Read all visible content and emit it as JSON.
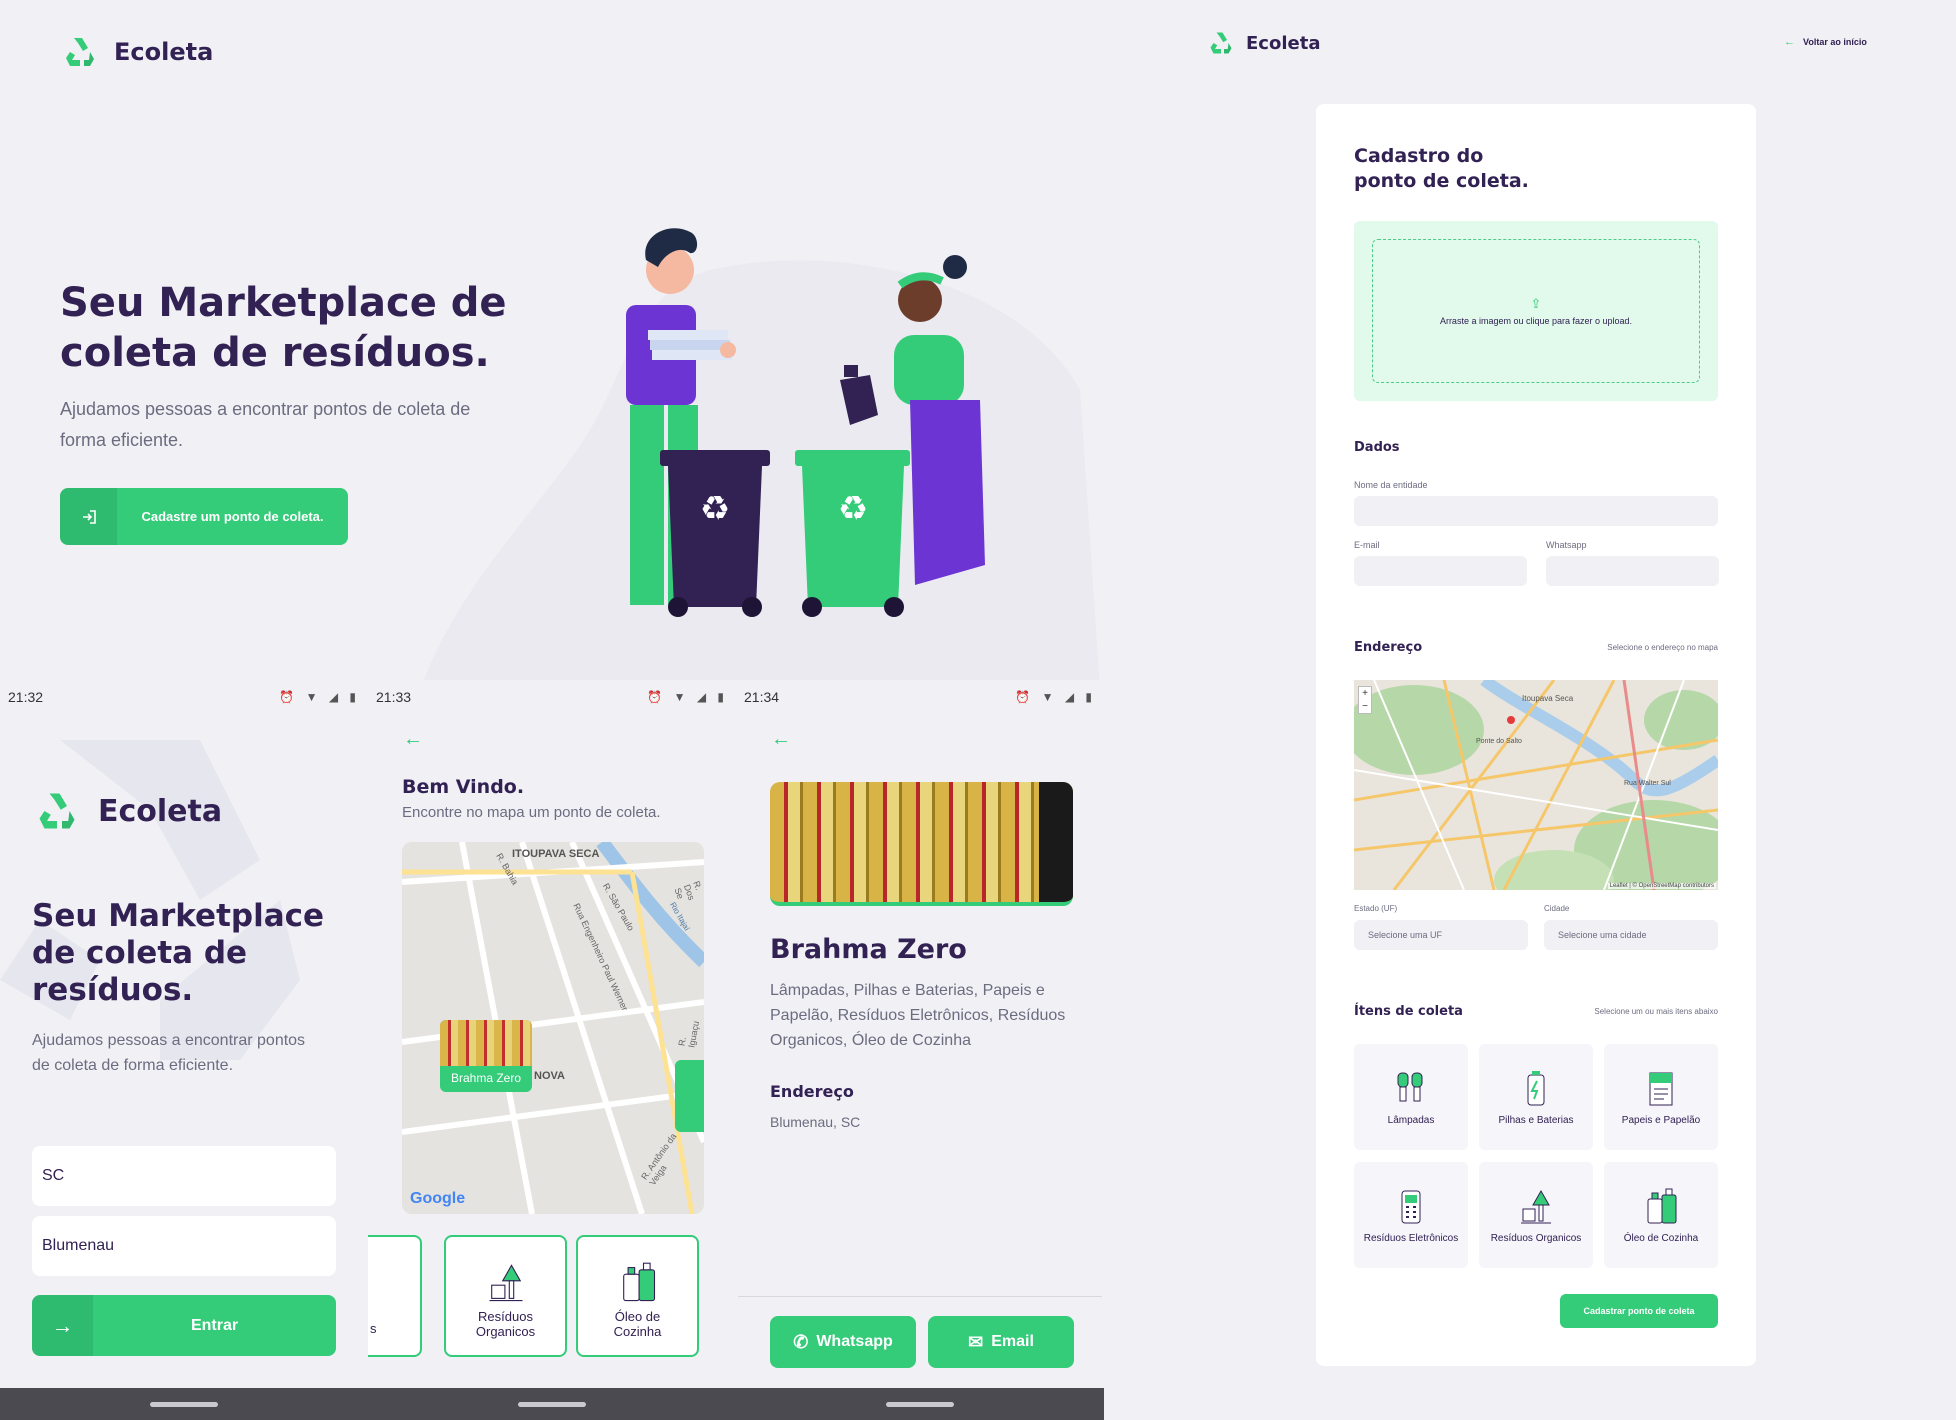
{
  "brand": {
    "name": "Ecoleta",
    "green": "#34cb79",
    "purple": "#322153",
    "gray": "#6c6c80"
  },
  "desktop_home": {
    "title": "Seu Marketplace de coleta de resíduos.",
    "subtitle": "Ajudamos pessoas a encontrar pontos de coleta de forma eficiente.",
    "cta_label": "Cadastre um ponto de coleta."
  },
  "desktop_form": {
    "back_link": "Voltar ao início",
    "title_line1": "Cadastro do",
    "title_line2": "ponto de coleta.",
    "dropzone_text": "Arraste a imagem ou clique para fazer o upload.",
    "section_dados": "Dados",
    "label_nome": "Nome da entidade",
    "label_email": "E-mail",
    "label_whatsapp": "Whatsapp",
    "section_endereco": "Endereço",
    "endereco_hint": "Selecione o endereço no mapa",
    "map_attribution": "Leaflet | © OpenStreetMap contributors",
    "map_places": [
      "Itoupava Seca",
      "Ponte do Salto",
      "Rua Walter Sul"
    ],
    "label_uf": "Estado (UF)",
    "placeholder_uf": "Selecione uma UF",
    "label_cidade": "Cidade",
    "placeholder_cidade": "Selecione uma cidade",
    "section_itens": "Ítens de coleta",
    "itens_hint": "Selecione um ou mais itens abaixo",
    "items": [
      {
        "label": "Lâmpadas",
        "icon": "lamp-icon"
      },
      {
        "label": "Pilhas e Baterias",
        "icon": "battery-icon"
      },
      {
        "label": "Papeis e Papelão",
        "icon": "paper-icon"
      },
      {
        "label": "Resíduos Eletrônicos",
        "icon": "electronics-icon"
      },
      {
        "label": "Resíduos Organicos",
        "icon": "organic-icon"
      },
      {
        "label": "Óleo de Cozinha",
        "icon": "oil-icon"
      }
    ],
    "submit_label": "Cadastrar ponto de coleta"
  },
  "phone_home": {
    "time": "21:32",
    "title": "Seu Marketplace de coleta de resíduos.",
    "subtitle": "Ajudamos pessoas a encontrar pontos de coleta de forma eficiente.",
    "uf_value": "SC",
    "city_value": "Blumenau",
    "enter_label": "Entrar"
  },
  "phone_map": {
    "time": "21:33",
    "title": "Bem Vindo.",
    "subtitle": "Encontre no mapa um ponto de coleta.",
    "marker_label": "Brahma Zero",
    "map_labels": [
      "ITOUPAVA SECA",
      "R. Bahia",
      "R. São Paulo",
      "Rua Engenheiro Paul Werner",
      "NOVA",
      "R. Antônio da Veiga",
      "R. Iguaçu",
      "Rio Itajaí",
      "R. Dos Se"
    ],
    "map_brand": "Google",
    "items": [
      {
        "label": "s",
        "icon": "partial-item-icon"
      },
      {
        "label": "Resíduos Organicos",
        "icon": "organic-icon"
      },
      {
        "label": "Óleo de Cozinha",
        "icon": "oil-icon"
      }
    ]
  },
  "phone_detail": {
    "time": "21:34",
    "name": "Brahma Zero",
    "items": "Lâmpadas, Pilhas e Baterias, Papeis e Papelão, Resíduos Eletrônicos, Resíduos Organicos, Óleo de Cozinha",
    "address_title": "Endereço",
    "address": "Blumenau, SC",
    "whatsapp_label": "Whatsapp",
    "email_label": "Email"
  }
}
